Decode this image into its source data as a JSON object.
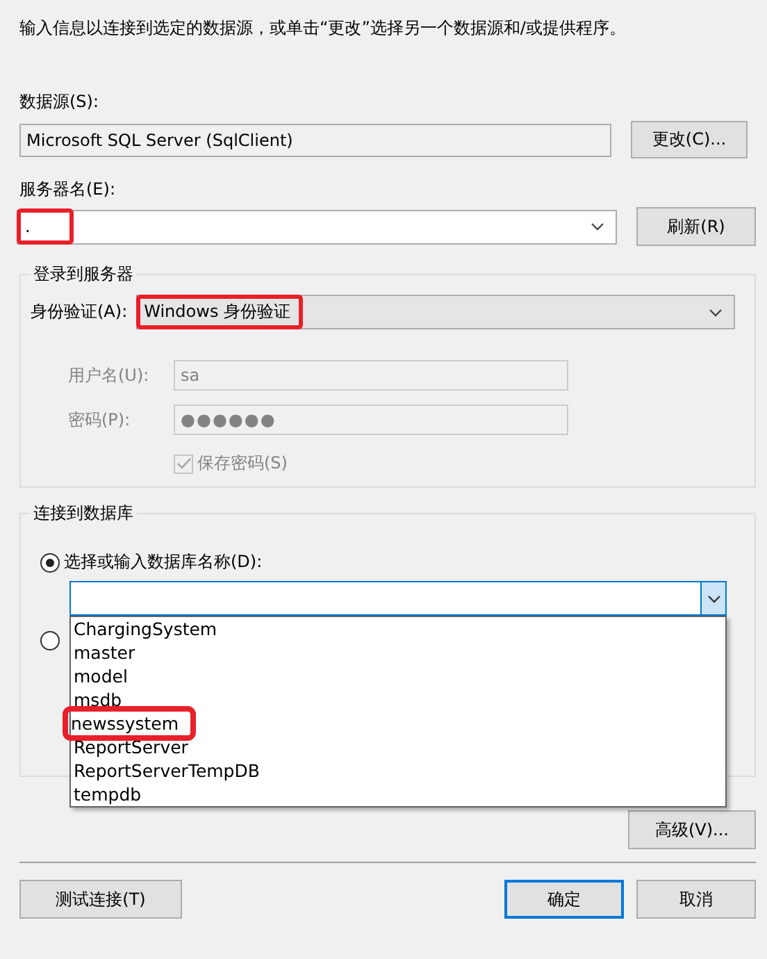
{
  "intro": "输入信息以连接到选定的数据源，或单击“更改”选择另一个数据源和/或提供程序。",
  "data_source": {
    "label": "数据源(S):",
    "value": "Microsoft SQL Server (SqlClient)",
    "button": "更改(C)..."
  },
  "server": {
    "label": "服务器名(E):",
    "value": ".",
    "annotated": true,
    "button": "刷新(R)"
  },
  "login": {
    "title": "登录到服务器",
    "auth": {
      "label": "身份验证(A):",
      "value": "Windows 身份验证",
      "annotated": true
    },
    "username": {
      "label": "用户名(U):",
      "value": "sa",
      "disabled": true
    },
    "password": {
      "label": "密码(P):",
      "value": "●●●●●●",
      "disabled": true
    },
    "save_password": {
      "label": "保存密码(S)",
      "checked": true,
      "disabled": true
    }
  },
  "database": {
    "title": "连接到数据库",
    "options": [
      {
        "label": "选择或输入数据库名称(D):",
        "selected": true
      },
      {
        "selected": false
      }
    ],
    "dropdown": {
      "expanded": true,
      "items": [
        {
          "label": "ChargingSystem",
          "annotated": false
        },
        {
          "label": "master",
          "annotated": false
        },
        {
          "label": "model",
          "annotated": false
        },
        {
          "label": "msdb",
          "annotated": false
        },
        {
          "label": "newssystem",
          "annotated": true
        },
        {
          "label": "ReportServer",
          "annotated": false
        },
        {
          "label": "ReportServerTempDB",
          "annotated": false
        },
        {
          "label": "tempdb",
          "annotated": false
        }
      ]
    }
  },
  "advanced_button": "高级(V)...",
  "buttons": [
    {
      "label": "测试连接(T)",
      "focused": false
    },
    {
      "label": "确定",
      "focused": true
    },
    {
      "label": "取消",
      "focused": false
    }
  ]
}
